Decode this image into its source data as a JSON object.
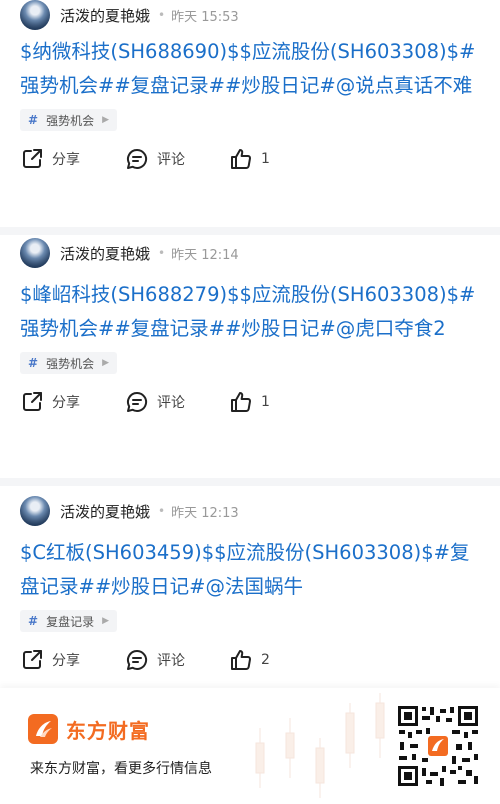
{
  "posts": [
    {
      "author": "活泼的夏艳娥",
      "time": "昨天 15:53",
      "content": "$纳微科技(SH688690)$$应流股份(SH603308)$#强势机会##复盘记录##炒股日记#@说点真话不难",
      "tag": "强势机会",
      "share_label": "分享",
      "comment_label": "评论",
      "likes": "1"
    },
    {
      "author": "活泼的夏艳娥",
      "time": "昨天 12:14",
      "content": "$峰岹科技(SH688279)$$应流股份(SH603308)$#强势机会##复盘记录##炒股日记#@虎口夺食2",
      "tag": "强势机会",
      "share_label": "分享",
      "comment_label": "评论",
      "likes": "1"
    },
    {
      "author": "活泼的夏艳娥",
      "time": "昨天 12:13",
      "content": "$C红板(SH603459)$$应流股份(SH603308)$#复盘记录##炒股日记#@法国蜗牛",
      "tag": "复盘记录",
      "share_label": "分享",
      "comment_label": "评论",
      "likes": "2"
    }
  ],
  "footer": {
    "brand": "东方财富",
    "slogan": "来东方财富，看更多行情信息"
  },
  "colors": {
    "link": "#1b6fc9",
    "brand": "#f36b21"
  },
  "icons": [
    "share-icon",
    "comment-icon",
    "like-icon",
    "tag-hash-icon",
    "tag-arrow-icon",
    "brand-logo-icon",
    "qr-code"
  ]
}
